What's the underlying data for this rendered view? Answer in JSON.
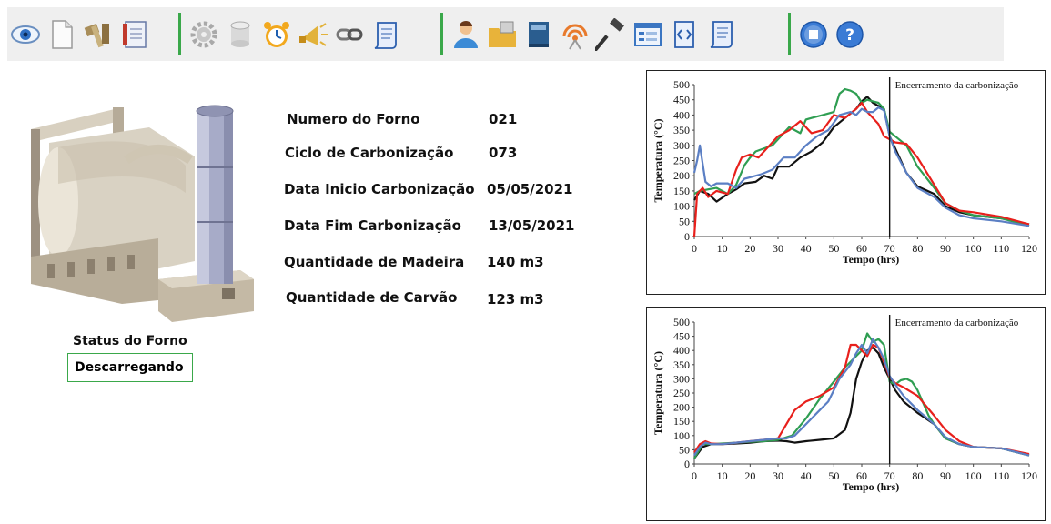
{
  "toolbar": {
    "buttons": [
      {
        "icon": "eye-icon"
      },
      {
        "icon": "new-document-icon"
      },
      {
        "icon": "hammer-tool-icon"
      },
      {
        "icon": "notebook-icon"
      },
      {
        "icon": "gear-icon"
      },
      {
        "icon": "database-icon"
      },
      {
        "icon": "alarm-clock-icon"
      },
      {
        "icon": "horn-icon"
      },
      {
        "icon": "link-icon"
      },
      {
        "icon": "scroll-icon"
      },
      {
        "icon": "user-icon"
      },
      {
        "icon": "folder-icon"
      },
      {
        "icon": "book-icon"
      },
      {
        "icon": "broadcast-icon"
      },
      {
        "icon": "hammer-icon"
      },
      {
        "icon": "form-icon"
      },
      {
        "icon": "code-document-icon"
      },
      {
        "icon": "script-icon"
      },
      {
        "icon": "stop-icon"
      },
      {
        "icon": "help-icon"
      }
    ]
  },
  "info": {
    "rows": [
      {
        "label": "Numero do Forno",
        "value": "021"
      },
      {
        "label": "Ciclo de Carbonização",
        "value": "073"
      },
      {
        "label": "Data Inicio Carbonização",
        "value": "05/05/2021"
      },
      {
        "label": "Data Fim Carbonização",
        "value": "13/05/2021"
      },
      {
        "label": "Quantidade de Madeira",
        "value": "140 m3"
      },
      {
        "label": "Quantidade de Carvão",
        "value": "123 m3"
      }
    ],
    "status_label": "Status do Forno",
    "status_value": "Descarregando"
  },
  "chart_data": [
    {
      "type": "line",
      "annotation": "Encerramento da carbonização",
      "annotation_x": 70,
      "xlabel": "Tempo (hrs)",
      "ylabel": "Temperatura (°C)",
      "xlim": [
        0,
        120
      ],
      "ylim": [
        0,
        500
      ],
      "xticks": [
        0,
        10,
        20,
        30,
        40,
        50,
        60,
        70,
        80,
        90,
        100,
        110,
        120
      ],
      "yticks": [
        0,
        50,
        100,
        150,
        200,
        250,
        300,
        350,
        400,
        450,
        500
      ],
      "series": [
        {
          "color": "#111111",
          "x": [
            0,
            2,
            5,
            8,
            12,
            15,
            18,
            22,
            25,
            28,
            30,
            34,
            38,
            42,
            46,
            50,
            54,
            58,
            60,
            62,
            64,
            66,
            68,
            70,
            72,
            76,
            80,
            86,
            90,
            95,
            100,
            110,
            120
          ],
          "y": [
            120,
            150,
            140,
            115,
            140,
            155,
            175,
            180,
            200,
            190,
            230,
            230,
            260,
            280,
            310,
            360,
            390,
            420,
            445,
            460,
            440,
            430,
            420,
            330,
            290,
            210,
            165,
            140,
            100,
            80,
            70,
            60,
            40
          ]
        },
        {
          "color": "#2f9e52",
          "x": [
            0,
            2,
            5,
            8,
            12,
            15,
            18,
            20,
            22,
            25,
            28,
            30,
            34,
            38,
            40,
            42,
            46,
            50,
            52,
            54,
            56,
            58,
            60,
            62,
            64,
            66,
            68,
            70,
            72,
            76,
            80,
            86,
            90,
            95,
            100,
            110,
            120
          ],
          "y": [
            140,
            150,
            155,
            160,
            140,
            170,
            235,
            260,
            280,
            290,
            300,
            320,
            360,
            340,
            385,
            390,
            400,
            410,
            470,
            485,
            480,
            470,
            440,
            450,
            445,
            440,
            420,
            345,
            330,
            300,
            230,
            160,
            110,
            85,
            70,
            60,
            35
          ]
        },
        {
          "color": "#e8201c",
          "x": [
            0,
            1,
            3,
            5,
            8,
            12,
            15,
            17,
            20,
            23,
            26,
            30,
            34,
            38,
            42,
            46,
            50,
            54,
            58,
            60,
            62,
            64,
            66,
            68,
            70,
            72,
            76,
            80,
            86,
            90,
            95,
            100,
            110,
            120
          ],
          "y": [
            0,
            140,
            160,
            130,
            150,
            140,
            220,
            260,
            270,
            260,
            290,
            330,
            350,
            380,
            340,
            350,
            400,
            390,
            420,
            440,
            410,
            390,
            370,
            330,
            320,
            310,
            305,
            260,
            170,
            110,
            85,
            80,
            65,
            40
          ]
        },
        {
          "color": "#5b7fc4",
          "x": [
            0,
            1,
            2,
            4,
            6,
            8,
            12,
            15,
            18,
            20,
            24,
            28,
            32,
            36,
            40,
            44,
            48,
            52,
            56,
            58,
            60,
            62,
            64,
            66,
            68,
            70,
            72,
            76,
            80,
            86,
            90,
            95,
            100,
            110,
            120
          ],
          "y": [
            210,
            250,
            300,
            180,
            165,
            175,
            175,
            160,
            190,
            195,
            205,
            220,
            260,
            260,
            300,
            330,
            350,
            400,
            410,
            400,
            420,
            410,
            410,
            425,
            415,
            330,
            280,
            210,
            160,
            130,
            95,
            70,
            60,
            50,
            35
          ]
        }
      ]
    },
    {
      "type": "line",
      "annotation": "Encerramento da carbonização",
      "annotation_x": 70,
      "xlabel": "Tempo (hrs)",
      "ylabel": "Temperatura (°C)",
      "xlim": [
        0,
        120
      ],
      "ylim": [
        0,
        500
      ],
      "xticks": [
        0,
        10,
        20,
        30,
        40,
        50,
        60,
        70,
        80,
        90,
        100,
        110,
        120
      ],
      "yticks": [
        0,
        50,
        100,
        150,
        200,
        250,
        300,
        350,
        400,
        450,
        500
      ],
      "series": [
        {
          "color": "#111111",
          "x": [
            0,
            3,
            6,
            10,
            15,
            20,
            25,
            30,
            33,
            36,
            40,
            45,
            50,
            54,
            56,
            58,
            60,
            62,
            64,
            66,
            68,
            70,
            72,
            75,
            80,
            86,
            90,
            95,
            100,
            110,
            120
          ],
          "y": [
            20,
            60,
            70,
            70,
            72,
            75,
            80,
            82,
            80,
            75,
            80,
            85,
            90,
            120,
            180,
            300,
            360,
            400,
            410,
            390,
            340,
            300,
            260,
            220,
            180,
            140,
            90,
            70,
            60,
            55,
            30
          ]
        },
        {
          "color": "#2f9e52",
          "x": [
            0,
            3,
            6,
            10,
            15,
            20,
            25,
            30,
            35,
            40,
            45,
            50,
            54,
            58,
            60,
            62,
            64,
            66,
            68,
            70,
            72,
            74,
            76,
            78,
            80,
            84,
            86,
            90,
            95,
            100,
            110,
            120
          ],
          "y": [
            20,
            70,
            70,
            72,
            75,
            78,
            80,
            85,
            100,
            160,
            230,
            290,
            340,
            380,
            400,
            460,
            430,
            440,
            420,
            290,
            280,
            295,
            300,
            290,
            260,
            170,
            140,
            90,
            70,
            60,
            55,
            30
          ]
        },
        {
          "color": "#e8201c",
          "x": [
            0,
            2,
            4,
            6,
            10,
            15,
            20,
            25,
            30,
            33,
            36,
            40,
            45,
            50,
            54,
            56,
            58,
            60,
            62,
            64,
            66,
            68,
            70,
            72,
            75,
            80,
            86,
            90,
            95,
            100,
            110,
            120
          ],
          "y": [
            40,
            70,
            80,
            72,
            70,
            75,
            80,
            85,
            90,
            140,
            190,
            220,
            240,
            270,
            340,
            420,
            420,
            400,
            380,
            420,
            410,
            360,
            305,
            285,
            270,
            240,
            170,
            120,
            80,
            60,
            55,
            35
          ]
        },
        {
          "color": "#5b7fc4",
          "x": [
            0,
            2,
            4,
            6,
            10,
            15,
            20,
            25,
            30,
            33,
            36,
            40,
            44,
            48,
            52,
            56,
            58,
            60,
            62,
            64,
            66,
            68,
            70,
            72,
            75,
            80,
            86,
            90,
            95,
            100,
            110,
            120
          ],
          "y": [
            30,
            60,
            75,
            70,
            70,
            75,
            80,
            85,
            90,
            90,
            100,
            140,
            180,
            220,
            300,
            350,
            390,
            420,
            390,
            440,
            410,
            370,
            310,
            280,
            240,
            190,
            140,
            95,
            70,
            60,
            55,
            30
          ]
        }
      ]
    }
  ]
}
